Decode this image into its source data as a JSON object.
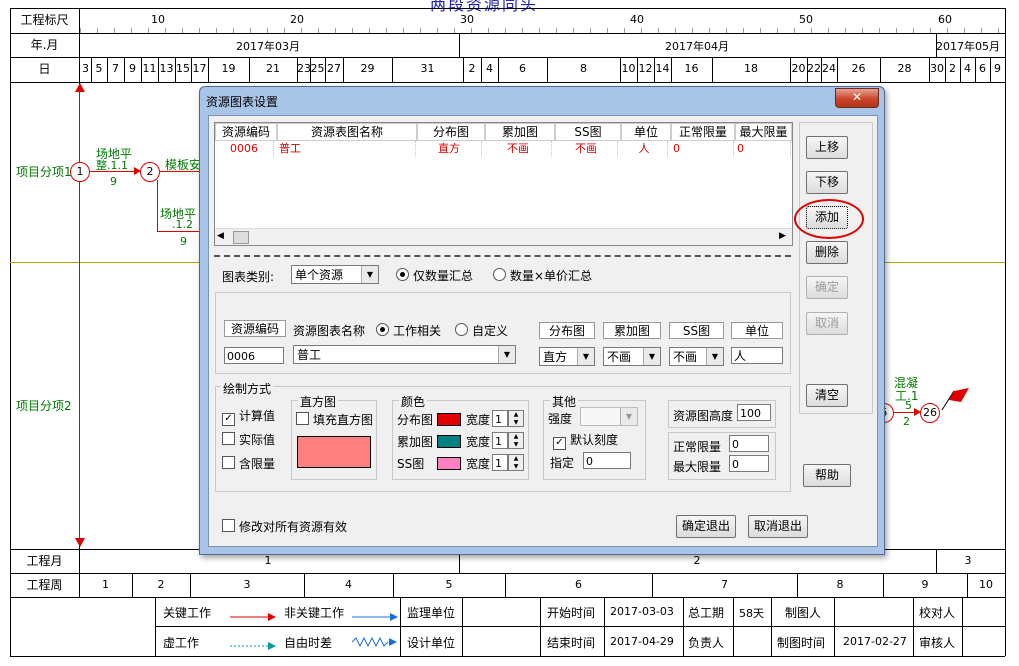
{
  "chart": {
    "title": "两段资源同头",
    "row_labels": {
      "scale": "工程标尺",
      "month": "年.月",
      "day": "日",
      "proj_month": "工程月",
      "proj_week": "工程周"
    },
    "scale_ticks": [
      "10",
      "20",
      "30",
      "40",
      "50",
      "60"
    ],
    "months": [
      "2017年03月",
      "2017年04月",
      "2017年05月"
    ],
    "days": [
      "3",
      "5",
      "7",
      "9",
      "11",
      "13",
      "15",
      "17",
      "19",
      "21",
      "23",
      "25",
      "27",
      "29",
      "31",
      "2",
      "4",
      "6",
      "8",
      "10",
      "12",
      "14",
      "16",
      "18",
      "20",
      "22",
      "24",
      "26",
      "28",
      "30",
      "2",
      "4",
      "6",
      "9"
    ],
    "proj_months": [
      "1",
      "2",
      "3"
    ],
    "proj_weeks": [
      "1",
      "2",
      "3",
      "4",
      "5",
      "6",
      "7",
      "8",
      "9",
      "10"
    ],
    "sections": [
      "项目分项1",
      "项目分项2"
    ],
    "nodes": [
      "1",
      "2",
      "5",
      "26"
    ],
    "task_labels": {
      "t1": "场地平",
      "t1b": "整.1.1",
      "t1d": "9",
      "t2": "模板安",
      "t3": "场地平",
      "t3b": ".1.2",
      "t3d": "9",
      "t4": "混凝",
      "t4b": "工.1",
      "t4c": "5",
      "t4d": "2"
    }
  },
  "legend": {
    "critical": "关键工作",
    "noncritical": "非关键工作",
    "virtual": "虚工作",
    "free_float": "自由时差",
    "supervisor": "监理单位",
    "designer": "设计单位",
    "start_label": "开始时间",
    "start_value": "2017-03-03",
    "end_label": "结束时间",
    "end_value": "2017-04-29",
    "duration_label": "总工期",
    "duration_value": "58天",
    "owner_label": "负责人",
    "maker_label": "制图人",
    "make_date_label": "制图时间",
    "make_date_value": "2017-02-27",
    "checker_label": "校对人",
    "auditor_label": "审核人"
  },
  "dialog": {
    "title": "资源图表设置",
    "close": "✕",
    "table": {
      "columns": [
        "资源编码",
        "资源表图名称",
        "分布图",
        "累加图",
        "SS图",
        "单位",
        "正常限量",
        "最大限量"
      ],
      "rows": [
        [
          "0006",
          "普工",
          "直方",
          "不画",
          "不画",
          "人",
          "0",
          "0"
        ]
      ]
    },
    "buttons": {
      "up": "上移",
      "down": "下移",
      "add": "添加",
      "delete": "删除",
      "confirm": "确定",
      "cancel": "取消",
      "clear": "清空",
      "help": "帮助",
      "ok_exit": "确定退出",
      "cancel_exit": "取消退出"
    },
    "chart_type_label": "图表类别:",
    "chart_type_value": "单个资源",
    "radio_qty": "仅数量汇总",
    "radio_price": "数量×单价汇总",
    "fields": {
      "code_header": "资源编码",
      "code_value": "0006",
      "name_header": "资源图表名称",
      "radio_work": "工作相关",
      "radio_custom": "自定义",
      "name_value": "普工",
      "dist_header": "分布图",
      "dist_value": "直方",
      "acc_header": "累加图",
      "acc_value": "不画",
      "ss_header": "SS图",
      "ss_value": "不画",
      "unit_header": "单位",
      "unit_value": "人"
    },
    "draw_mode": {
      "title": "绘制方式",
      "calc": "计算值",
      "actual": "实际值",
      "limit": "含限量"
    },
    "histogram": {
      "title": "直方图",
      "fill": "填充直方图"
    },
    "colors": {
      "title": "颜色",
      "dist": "分布图",
      "acc": "累加图",
      "ss": "SS图",
      "width": "宽度",
      "w1": "1",
      "w2": "1",
      "w3": "1",
      "dist_color": "#e00000",
      "acc_color": "#008080",
      "ss_color": "#ff80c0",
      "hist_color": "#ff8080"
    },
    "other": {
      "title": "其他",
      "strength": "强度",
      "default_scale": "默认刻度",
      "specify": "指定",
      "specify_value": "0"
    },
    "height_label": "资源图高度",
    "height_value": "100",
    "normal_limit_label": "正常限量",
    "normal_limit_value": "0",
    "max_limit_label": "最大限量",
    "max_limit_value": "0",
    "apply_all": "修改对所有资源有效"
  }
}
